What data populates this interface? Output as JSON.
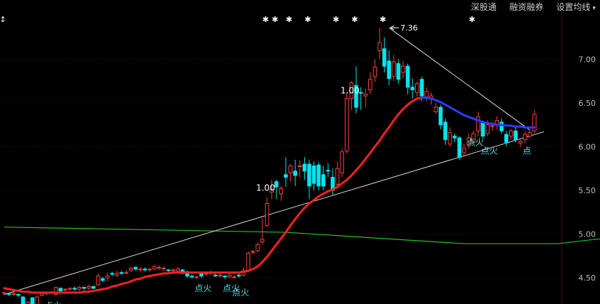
{
  "toolbar": {
    "items": [
      "深股通",
      "融资融券",
      "设置均线"
    ],
    "dropdown_glyph": "▾"
  },
  "colors": {
    "background": "#000000",
    "up_candle": "#ff3c3c",
    "down_candle": "#00e5ee",
    "ma_up": "#ff2020",
    "ma_down": "#2a3cff",
    "ma_long": "#22c622",
    "trendline": "#d8d8d8",
    "axis_text": "#bdbdbd",
    "grid": "#3a0000",
    "signal_text": "#59e3e9",
    "marker": "#ffffff"
  },
  "chart_data": {
    "type": "candlestick",
    "ylim": [
      4.2,
      7.45
    ],
    "yticks": [
      4.5,
      5.0,
      5.5,
      6.0,
      6.5,
      7.0
    ],
    "ytick_labels": [
      "4.50",
      "5.00",
      "5.50",
      "6.00",
      "6.50",
      "7.00"
    ],
    "peak_label": "7.36",
    "peak_value": 7.36,
    "candles": [
      [
        4.32,
        4.33,
        4.3,
        4.34
      ],
      [
        4.32,
        4.31,
        4.29,
        4.33
      ],
      [
        4.31,
        4.32,
        4.29,
        4.34
      ],
      [
        4.31,
        4.3,
        4.28,
        4.32
      ],
      [
        4.28,
        4.18,
        4.16,
        4.29
      ],
      [
        4.16,
        4.22,
        4.14,
        4.23
      ],
      [
        4.27,
        4.18,
        4.14,
        4.28
      ],
      [
        4.18,
        4.28,
        4.16,
        4.3
      ],
      [
        4.3,
        4.32,
        4.29,
        4.33
      ],
      [
        4.32,
        4.33,
        4.3,
        4.34
      ],
      [
        4.33,
        4.33,
        4.31,
        4.35
      ],
      [
        4.31,
        4.39,
        4.3,
        4.4
      ],
      [
        4.38,
        4.35,
        4.33,
        4.39
      ],
      [
        4.36,
        4.37,
        4.34,
        4.38
      ],
      [
        4.37,
        4.38,
        4.35,
        4.39
      ],
      [
        4.38,
        4.37,
        4.35,
        4.4
      ],
      [
        4.37,
        4.39,
        4.35,
        4.41
      ],
      [
        4.39,
        4.38,
        4.36,
        4.4
      ],
      [
        4.38,
        4.4,
        4.36,
        4.42
      ],
      [
        4.4,
        4.38,
        4.37,
        4.41
      ],
      [
        4.42,
        4.52,
        4.41,
        4.55
      ],
      [
        4.49,
        4.47,
        4.45,
        4.51
      ],
      [
        4.5,
        4.52,
        4.46,
        4.56
      ],
      [
        4.55,
        4.54,
        4.52,
        4.57
      ],
      [
        4.53,
        4.55,
        4.51,
        4.58
      ],
      [
        4.56,
        4.55,
        4.53,
        4.58
      ],
      [
        4.55,
        4.56,
        4.54,
        4.59
      ],
      [
        4.59,
        4.61,
        4.57,
        4.62
      ],
      [
        4.62,
        4.6,
        4.58,
        4.63
      ],
      [
        4.59,
        4.6,
        4.57,
        4.62
      ],
      [
        4.6,
        4.59,
        4.57,
        4.62
      ],
      [
        4.59,
        4.6,
        4.57,
        4.61
      ],
      [
        4.6,
        4.63,
        4.59,
        4.65
      ],
      [
        4.61,
        4.62,
        4.59,
        4.64
      ],
      [
        4.6,
        4.61,
        4.58,
        4.63
      ],
      [
        4.59,
        4.58,
        4.56,
        4.6
      ],
      [
        4.58,
        4.59,
        4.55,
        4.61
      ],
      [
        4.58,
        4.6,
        4.56,
        4.62
      ],
      [
        4.59,
        4.55,
        4.54,
        4.6
      ],
      [
        4.57,
        4.52,
        4.5,
        4.58
      ],
      [
        4.52,
        4.51,
        4.49,
        4.53
      ],
      [
        4.5,
        4.51,
        4.49,
        4.52
      ],
      [
        4.55,
        4.52,
        4.5,
        4.57
      ],
      [
        4.55,
        4.55,
        4.52,
        4.57
      ],
      [
        4.55,
        4.56,
        4.53,
        4.58
      ],
      [
        4.53,
        4.52,
        4.51,
        4.55
      ],
      [
        4.52,
        4.53,
        4.5,
        4.55
      ],
      [
        4.52,
        4.51,
        4.49,
        4.53
      ],
      [
        4.51,
        4.53,
        4.5,
        4.55
      ],
      [
        4.51,
        4.51,
        4.49,
        4.53
      ],
      [
        4.53,
        4.52,
        4.5,
        4.55
      ],
      [
        4.53,
        4.58,
        4.52,
        4.62
      ],
      [
        4.58,
        4.78,
        4.56,
        4.8
      ],
      [
        4.8,
        4.8,
        4.77,
        4.82
      ],
      [
        4.81,
        4.88,
        4.79,
        4.9
      ],
      [
        4.91,
        4.94,
        4.88,
        5.18
      ],
      [
        5.1,
        5.35,
        5.08,
        5.42
      ],
      [
        5.48,
        5.51,
        5.4,
        5.62
      ],
      [
        5.6,
        5.54,
        5.4,
        5.62
      ],
      [
        5.46,
        5.52,
        5.38,
        5.55
      ],
      [
        5.68,
        5.65,
        5.54,
        5.88
      ],
      [
        5.7,
        5.78,
        5.6,
        5.8
      ],
      [
        5.72,
        5.67,
        5.55,
        5.85
      ],
      [
        5.78,
        5.78,
        5.65,
        5.84
      ],
      [
        5.8,
        5.72,
        5.62,
        5.88
      ],
      [
        5.8,
        5.55,
        5.4,
        5.85
      ],
      [
        5.78,
        5.58,
        5.5,
        5.83
      ],
      [
        5.79,
        5.55,
        5.5,
        5.82
      ],
      [
        5.68,
        5.55,
        5.5,
        5.78
      ],
      [
        5.73,
        5.72,
        5.65,
        5.81
      ],
      [
        5.65,
        5.5,
        5.45,
        5.75
      ],
      [
        5.57,
        5.75,
        5.52,
        5.83
      ],
      [
        5.7,
        5.94,
        5.65,
        5.98
      ],
      [
        5.95,
        6.55,
        5.92,
        6.62
      ],
      [
        6.55,
        6.73,
        6.42,
        6.75
      ],
      [
        6.7,
        6.45,
        6.38,
        6.92
      ],
      [
        6.62,
        6.61,
        6.42,
        6.68
      ],
      [
        6.58,
        6.6,
        6.45,
        6.66
      ],
      [
        6.65,
        6.77,
        6.6,
        6.85
      ],
      [
        6.8,
        6.91,
        6.74,
        7.0
      ],
      [
        7.1,
        7.19,
        7.0,
        7.36
      ],
      [
        7.12,
        6.92,
        6.85,
        7.25
      ],
      [
        6.98,
        6.78,
        6.7,
        7.1
      ],
      [
        6.8,
        6.97,
        6.75,
        7.05
      ],
      [
        6.95,
        6.77,
        6.72,
        7.0
      ],
      [
        6.85,
        6.92,
        6.78,
        6.98
      ],
      [
        6.92,
        6.68,
        6.6,
        6.95
      ],
      [
        6.68,
        6.65,
        6.55,
        6.78
      ],
      [
        6.62,
        6.72,
        6.57,
        6.75
      ],
      [
        6.77,
        6.58,
        6.52,
        6.8
      ],
      [
        6.57,
        6.63,
        6.52,
        6.68
      ],
      [
        6.55,
        6.58,
        6.48,
        6.62
      ],
      [
        6.4,
        6.45,
        6.38,
        6.5
      ],
      [
        6.45,
        6.25,
        6.2,
        6.48
      ],
      [
        6.28,
        6.08,
        6.02,
        6.32
      ],
      [
        6.03,
        6.16,
        6.0,
        6.22
      ],
      [
        6.12,
        6.1,
        6.05,
        6.15
      ],
      [
        6.1,
        5.88,
        5.85,
        6.12
      ],
      [
        5.93,
        5.98,
        5.88,
        6.03
      ],
      [
        6.02,
        6.1,
        5.98,
        6.15
      ],
      [
        6.05,
        6.15,
        6.02,
        6.18
      ],
      [
        6.18,
        6.34,
        6.12,
        6.4
      ],
      [
        6.27,
        6.12,
        6.08,
        6.3
      ],
      [
        6.15,
        6.25,
        6.12,
        6.3
      ],
      [
        6.23,
        6.24,
        6.18,
        6.28
      ],
      [
        6.25,
        6.3,
        6.2,
        6.35
      ],
      [
        6.28,
        6.18,
        6.15,
        6.32
      ],
      [
        6.14,
        6.05,
        6.0,
        6.18
      ],
      [
        6.12,
        6.18,
        6.08,
        6.2
      ],
      [
        6.18,
        6.08,
        6.05,
        6.22
      ],
      [
        6.04,
        6.06,
        6.0,
        6.08
      ],
      [
        6.08,
        6.14,
        6.04,
        6.18
      ],
      [
        6.12,
        6.16,
        6.1,
        6.2
      ],
      [
        6.18,
        6.37,
        6.15,
        6.42
      ]
    ],
    "ma_short": [
      4.38,
      4.37,
      4.36,
      4.35,
      4.34,
      4.34,
      4.33,
      4.33,
      4.33,
      4.33,
      4.33,
      4.33,
      4.33,
      4.33,
      4.33,
      4.33,
      4.33,
      4.34,
      4.34,
      4.35,
      4.36,
      4.37,
      4.38,
      4.4,
      4.41,
      4.43,
      4.44,
      4.46,
      4.48,
      4.49,
      4.51,
      4.52,
      4.53,
      4.54,
      4.55,
      4.55,
      4.56,
      4.56,
      4.56,
      4.56,
      4.56,
      4.56,
      4.56,
      4.56,
      4.56,
      4.56,
      4.56,
      4.56,
      4.56,
      4.56,
      4.56,
      4.57,
      4.58,
      4.6,
      4.63,
      4.68,
      4.74,
      4.81,
      4.88,
      4.95,
      5.02,
      5.1,
      5.17,
      5.24,
      5.3,
      5.35,
      5.39,
      5.43,
      5.46,
      5.49,
      5.51,
      5.54,
      5.58,
      5.62,
      5.67,
      5.73,
      5.79,
      5.86,
      5.93,
      6.0,
      6.07,
      6.15,
      6.22,
      6.3,
      6.37,
      6.43,
      6.48,
      6.52,
      6.55,
      6.56,
      6.56,
      6.55,
      6.53,
      6.51,
      6.48,
      6.45,
      6.42,
      6.39,
      6.36,
      6.34,
      6.32,
      6.3,
      6.28,
      6.27,
      6.26,
      6.25,
      6.25,
      6.24,
      6.24,
      6.23,
      6.23,
      6.22,
      6.22,
      6.22
    ],
    "ma_trend": [
      1,
      1,
      1,
      1,
      1,
      1,
      1,
      1,
      1,
      1,
      1,
      1,
      1,
      1,
      1,
      1,
      1,
      1,
      1,
      1,
      1,
      1,
      1,
      1,
      1,
      1,
      1,
      1,
      1,
      1,
      1,
      1,
      1,
      1,
      1,
      1,
      1,
      1,
      1,
      1,
      1,
      1,
      1,
      1,
      1,
      1,
      1,
      1,
      1,
      1,
      1,
      1,
      1,
      1,
      1,
      1,
      1,
      1,
      1,
      1,
      1,
      1,
      1,
      1,
      1,
      1,
      1,
      1,
      1,
      1,
      1,
      1,
      1,
      1,
      1,
      1,
      1,
      1,
      1,
      1,
      1,
      1,
      1,
      1,
      1,
      1,
      1,
      1,
      1,
      -1,
      -1,
      -1,
      -1,
      -1,
      -1,
      -1,
      -1,
      -1,
      -1,
      -1,
      -1,
      -1,
      -1,
      -1,
      -1,
      -1,
      -1,
      -1,
      -1,
      -1,
      -1,
      -1,
      -1,
      -1
    ],
    "ma_long": [
      [
        0,
        5.08
      ],
      [
        60,
        5.02
      ],
      [
        98,
        4.89
      ],
      [
        118,
        4.89
      ],
      [
        126,
        4.94
      ],
      [
        160,
        5.04
      ],
      [
        200,
        5.09
      ],
      [
        214,
        5.11
      ]
    ],
    "trendlines": [
      {
        "from": [
          0,
          4.31
        ],
        "to": [
          115,
          6.17
        ]
      },
      {
        "from": [
          82,
          7.36
        ],
        "to": [
          112,
          6.19
        ]
      }
    ],
    "top_markers": {
      "symbols": [
        "↕",
        "✱",
        "✱",
        "✱",
        "✱",
        "✱",
        "✱",
        "✱",
        "✱"
      ],
      "index": [
        0,
        56,
        58,
        61,
        65,
        71,
        75,
        81,
        100
      ]
    },
    "value_labels": [
      {
        "text": "1.00",
        "index": 56,
        "value": 5.53
      },
      {
        "text": "1.00",
        "index": 74,
        "value": 6.64
      }
    ],
    "signals": [
      {
        "text": "点火",
        "index": 11,
        "value": 4.18
      },
      {
        "text": "点火",
        "index": 43,
        "value": 4.38
      },
      {
        "text": "点火",
        "index": 49,
        "value": 4.38
      },
      {
        "text": "点火",
        "index": 51,
        "value": 4.33
      },
      {
        "text": "点火",
        "index": 101,
        "value": 6.05
      },
      {
        "text": "点火",
        "index": 104,
        "value": 5.95
      },
      {
        "text": "点",
        "index": 112,
        "value": 5.95
      }
    ]
  }
}
